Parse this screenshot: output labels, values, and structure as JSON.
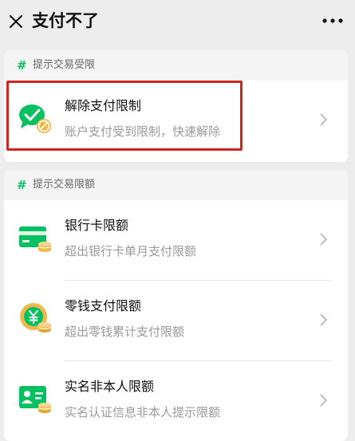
{
  "header": {
    "title": "支付不了"
  },
  "sections": [
    {
      "title": "提示交易受限",
      "items": [
        {
          "title": "解除支付限制",
          "subtitle": "账户支付受到限制，快速解除",
          "icon": "unlock-payment-icon"
        }
      ]
    },
    {
      "title": "提示交易限额",
      "items": [
        {
          "title": "银行卡限额",
          "subtitle": "超出银行卡单月支付限额",
          "icon": "bank-card-icon"
        },
        {
          "title": "零钱支付限额",
          "subtitle": "超出零钱累计支付限额",
          "icon": "balance-yen-icon"
        },
        {
          "title": "实名非本人限额",
          "subtitle": "实名认证信息非本人提示限额",
          "icon": "id-card-icon"
        }
      ]
    }
  ],
  "colors": {
    "accent_green": "#07c160",
    "highlight_red": "#d1231d"
  }
}
